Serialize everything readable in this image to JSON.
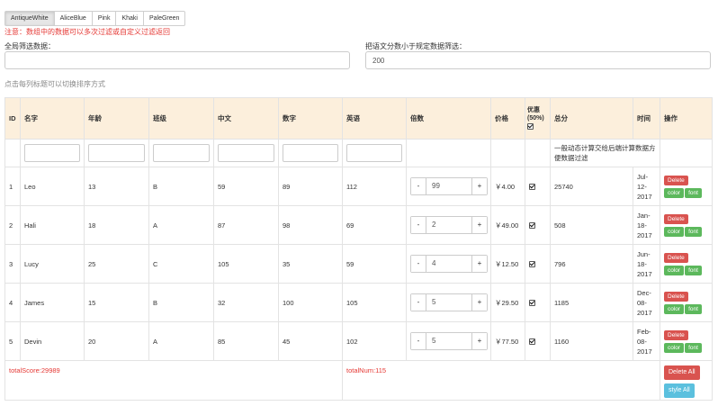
{
  "themes": [
    "AntiqueWhite",
    "AliceBlue",
    "Pink",
    "Khaki",
    "PaleGreen"
  ],
  "notice": "注意：数组中的数据可以多次过滤或自定义过滤返回",
  "global_filter": {
    "label": "全局筛选数据：",
    "value": ""
  },
  "english_filter": {
    "label": "把语文分数小于规定数据筛选：",
    "value": "200"
  },
  "sort_hint": "点击每列标题可以切换排序方式",
  "columns": {
    "id": "ID",
    "name": "名字",
    "age": "年龄",
    "class": "班级",
    "chinese": "中文",
    "math": "数字",
    "english": "英语",
    "multiple": "倍数",
    "price": "价格",
    "discount": "优惠",
    "discount_pct": "(50%)",
    "total": "总分",
    "time": "时间",
    "ops": "操作"
  },
  "calc_note": "一般动态计算交给后端计算数据方便数据过滤",
  "rows": [
    {
      "id": "1",
      "name": "Leo",
      "age": "13",
      "class": "B",
      "chinese": "59",
      "math": "89",
      "english": "112",
      "multiple": "99",
      "price": "￥4.00",
      "total": "25740",
      "time": [
        "Jul-",
        "12-",
        "2017"
      ]
    },
    {
      "id": "2",
      "name": "Hali",
      "age": "18",
      "class": "A",
      "chinese": "87",
      "math": "98",
      "english": "69",
      "multiple": "2",
      "price": "￥49.00",
      "total": "508",
      "time": [
        "Jan-",
        "18-",
        "2017"
      ]
    },
    {
      "id": "3",
      "name": "Lucy",
      "age": "25",
      "class": "C",
      "chinese": "105",
      "math": "35",
      "english": "59",
      "multiple": "4",
      "price": "￥12.50",
      "total": "796",
      "time": [
        "Jun-",
        "18-",
        "2017"
      ]
    },
    {
      "id": "4",
      "name": "James",
      "age": "15",
      "class": "B",
      "chinese": "32",
      "math": "100",
      "english": "105",
      "multiple": "5",
      "price": "￥29.50",
      "total": "1185",
      "time": [
        "Dec-",
        "08-",
        "2017"
      ]
    },
    {
      "id": "5",
      "name": "Devin",
      "age": "20",
      "class": "A",
      "chinese": "85",
      "math": "45",
      "english": "102",
      "multiple": "5",
      "price": "￥77.50",
      "total": "1160",
      "time": [
        "Feb-",
        "08-",
        "2017"
      ]
    }
  ],
  "row_actions": {
    "delete": "Delete",
    "color": "color",
    "font": "font",
    "minus": "-",
    "plus": "+"
  },
  "footer": {
    "total_score": "totalScore:29989",
    "total_num": "totalNum:115",
    "delete_all": "Delete All",
    "style_all": "style All"
  },
  "colors": {
    "header_bg": "#fcefdc",
    "danger": "#d9534f",
    "success": "#5cb85c",
    "info": "#5bc0de",
    "notice": "#e53935"
  }
}
